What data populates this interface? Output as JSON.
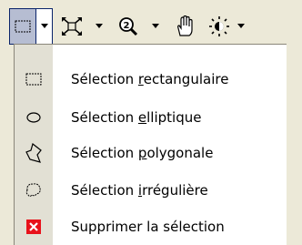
{
  "toolbar": {
    "buttons": [
      {
        "icon": "rectangle-selection-icon",
        "label": ""
      },
      {
        "icon": "fit-zoom-icon",
        "label": ""
      },
      {
        "icon": "magnifier-icon",
        "label": ""
      },
      {
        "icon": "pan-hand-icon",
        "label": ""
      },
      {
        "icon": "brightness-icon",
        "label": ""
      }
    ],
    "accent_color": "#0a246a"
  },
  "menu": {
    "items": [
      {
        "icon": "rectangle-selection-icon",
        "pre": "Sélection ",
        "mnemonic": "r",
        "post": "ectangulaire"
      },
      {
        "icon": "ellipse-selection-icon",
        "pre": "Sélection ",
        "mnemonic": "e",
        "post": "lliptique"
      },
      {
        "icon": "polygon-selection-icon",
        "pre": "Sélection ",
        "mnemonic": "p",
        "post": "olygonale"
      },
      {
        "icon": "freehand-selection-icon",
        "pre": "Sélection ",
        "mnemonic": "i",
        "post": "rrégulière"
      },
      {
        "icon": "delete-selection-icon",
        "pre": "Supprimer la sélection",
        "mnemonic": "",
        "post": ""
      }
    ],
    "delete_icon_color": "#e8121b"
  }
}
